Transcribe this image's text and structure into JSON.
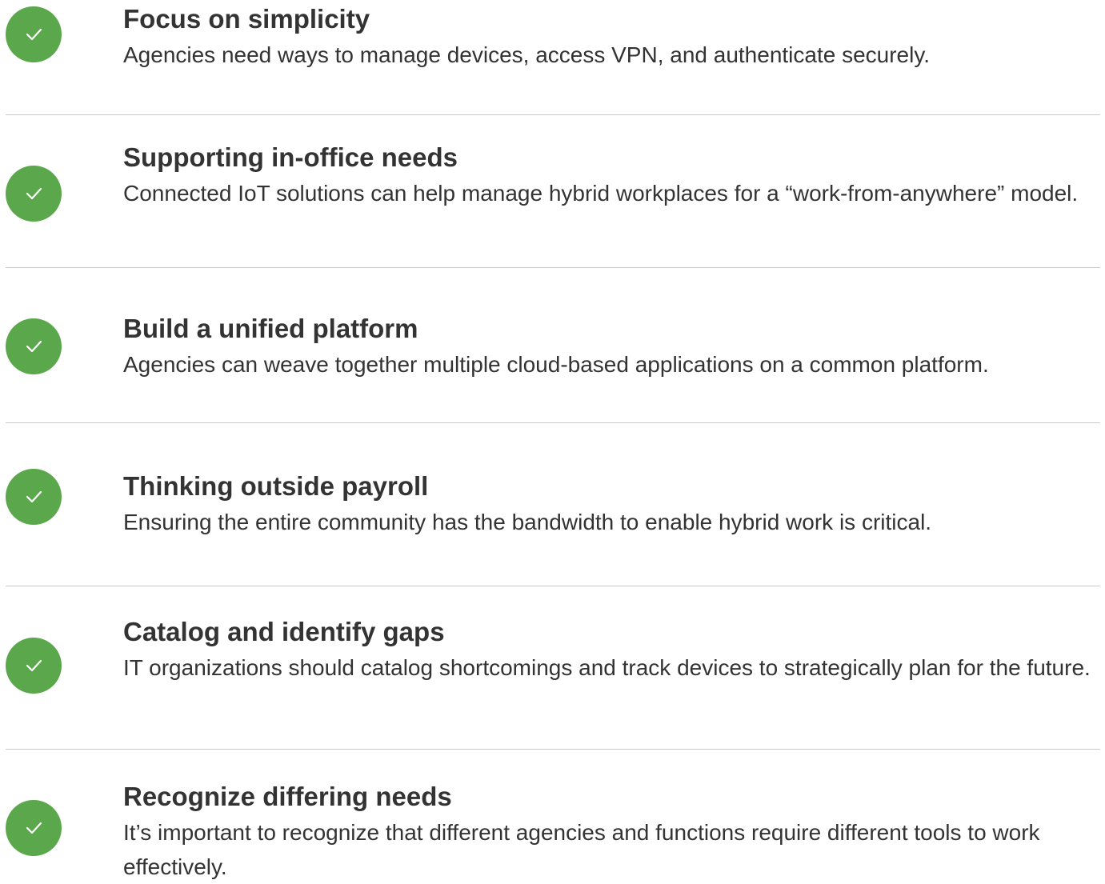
{
  "accent_color": "#5aa84b",
  "items": [
    {
      "icon": "check-icon",
      "title": "Focus on simplicity",
      "description": "Agencies need ways to manage devices, access VPN, and authenticate securely."
    },
    {
      "icon": "check-icon",
      "title": "Supporting in-office needs",
      "description": "Connected IoT solutions can help manage hybrid workplaces for a “work-from-anywhere” model."
    },
    {
      "icon": "check-icon",
      "title": "Build a unified platform",
      "description": "Agencies can weave together multiple cloud-based applications on a common platform."
    },
    {
      "icon": "check-icon",
      "title": "Thinking outside payroll",
      "description": "Ensuring the entire community has the bandwidth to enable hybrid work is critical."
    },
    {
      "icon": "check-icon",
      "title": "Catalog and identify gaps",
      "description": "IT organizations should catalog shortcomings and track devices to strategically plan for the future."
    },
    {
      "icon": "check-icon",
      "title": "Recognize differing needs",
      "description": "It’s important to recognize that different agencies and functions require different tools to work effectively."
    }
  ]
}
